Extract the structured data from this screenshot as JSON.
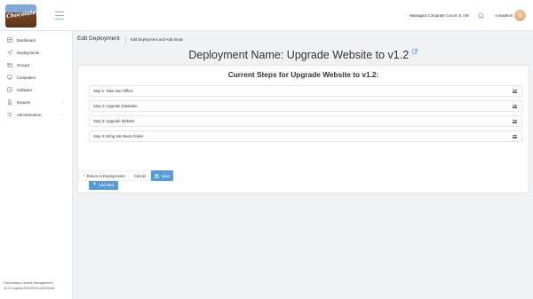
{
  "colors": {
    "accent": "#5b9bd5",
    "topbar_bg": "#ffffff",
    "page_bg": "#f1f2f4"
  },
  "header": {
    "logo_text": "Chocolatey",
    "managed_count": "Managed Computer Count: 5 / 50",
    "username": "ccmadmin"
  },
  "sidebar": {
    "items": [
      {
        "label": "Dashboard",
        "icon": "dashboard-icon"
      },
      {
        "label": "Deployments",
        "icon": "deployments-icon"
      },
      {
        "label": "Groups",
        "icon": "groups-icon"
      },
      {
        "label": "Computers",
        "icon": "computer-icon"
      },
      {
        "label": "Software",
        "icon": "software-icon"
      },
      {
        "label": "Reports",
        "icon": "reports-icon",
        "has_submenu": true
      },
      {
        "label": "Administration",
        "icon": "admin-icon",
        "has_submenu": true
      }
    ],
    "footer_line1": "Chocolatey Central Management",
    "footer_line2": "v0.2.0-alpha-20200219-0151Sxb9"
  },
  "page": {
    "title": "Edit Deployment",
    "subtitle": "Edit Deployment and Add Steps",
    "deployment_heading": "Deployment Name: Upgrade Website to v1.2"
  },
  "steps_panel": {
    "title": "Current Steps for Upgrade Website to v1.2:",
    "steps": [
      "Step 1: Take Site Offline",
      "Step 2: Upgrade Database",
      "Step 3: Upgrade Website",
      "Step 4: Bring Site Back Online"
    ],
    "add_new_label": "Add New"
  },
  "actions": {
    "return_label": "Return to Deployments",
    "cancel_label": "Cancel",
    "save_label": "Save"
  }
}
